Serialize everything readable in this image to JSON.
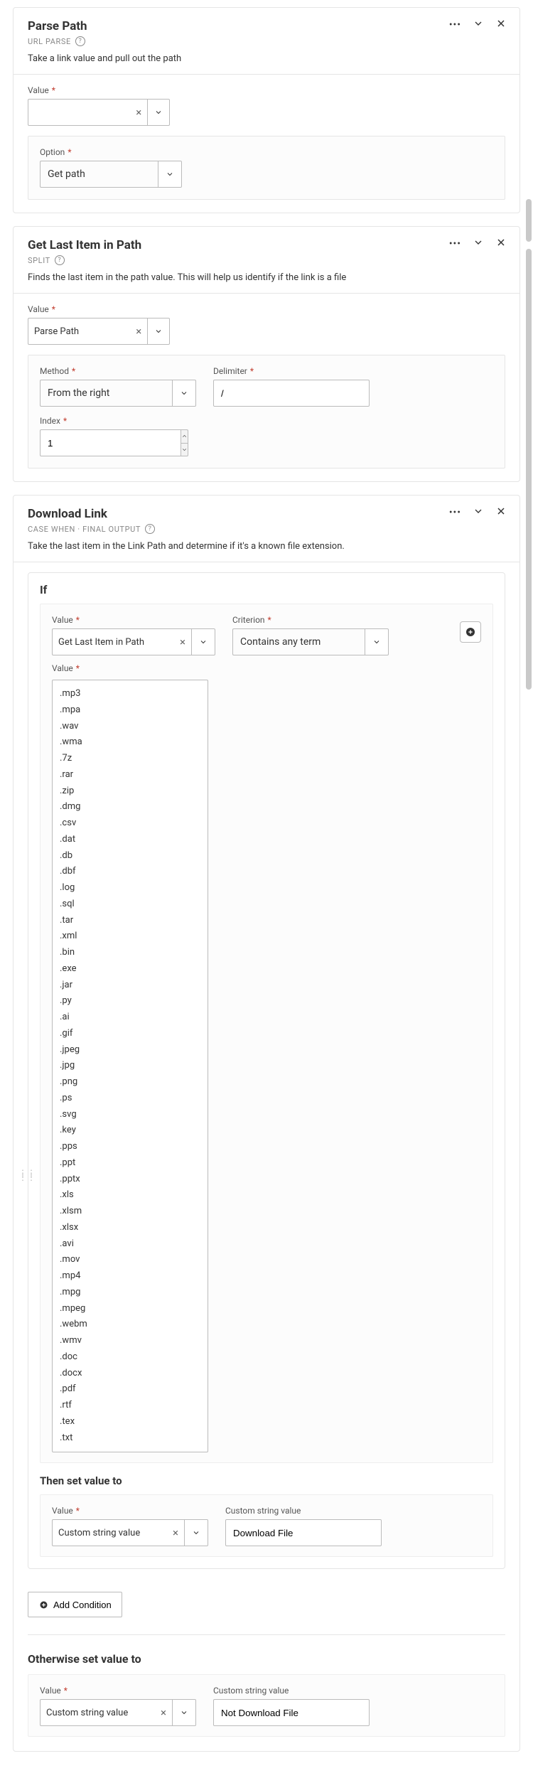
{
  "cards": {
    "parsePath": {
      "title": "Parse Path",
      "subtype": "URL PARSE",
      "description": "Take a link value and pull out the path",
      "valueLabel": "Value",
      "optionLabel": "Option",
      "optionValue": "Get path"
    },
    "getLast": {
      "title": "Get Last Item in Path",
      "subtype": "SPLIT",
      "description": "Finds the last item in the path value. This will help us identify if the link is a file",
      "valueLabel": "Value",
      "valueSelected": "Parse Path",
      "methodLabel": "Method",
      "methodValue": "From the right",
      "delimiterLabel": "Delimiter",
      "delimiterValue": "/",
      "indexLabel": "Index",
      "indexValue": "1"
    },
    "downloadLink": {
      "title": "Download Link",
      "subtype": "CASE WHEN · FINAL OUTPUT",
      "description": "Take the last item in the Link Path and determine if it's a known file extension.",
      "ifTitle": "If",
      "ifValueLabel": "Value",
      "ifValueSelected": "Get Last Item in Path",
      "criterionLabel": "Criterion",
      "criterionValue": "Contains any term",
      "extListLabel": "Value",
      "extList": ".mp3\n.mpa\n.wav\n.wma\n.7z\n.rar\n.zip\n.dmg\n.csv\n.dat\n.db\n.dbf\n.log\n.sql\n.tar\n.xml\n.bin\n.exe\n.jar\n.py\n.ai\n.gif\n.jpeg\n.jpg\n.png\n.ps\n.svg\n.key\n.pps\n.ppt\n.pptx\n.xls\n.xlsm\n.xlsx\n.avi\n.mov\n.mp4\n.mpg\n.mpeg\n.webm\n.wmv\n.doc\n.docx\n.pdf\n.rtf\n.tex\n.txt",
      "thenTitle": "Then set value to",
      "thenValueLabel": "Value",
      "thenValueSelected": "Custom string value",
      "thenCustomLabel": "Custom string value",
      "thenCustomValue": "Download File",
      "addCondition": "Add Condition",
      "otherwiseTitle": "Otherwise set value to",
      "otherwiseValueLabel": "Value",
      "otherwiseValueSelected": "Custom string value",
      "otherwiseCustomLabel": "Custom string value",
      "otherwiseCustomValue": "Not Download File"
    }
  }
}
